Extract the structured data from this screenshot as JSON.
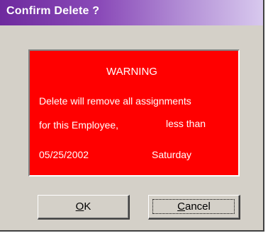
{
  "window": {
    "title": "Confirm Delete ?"
  },
  "warning": {
    "background_color": "#ff0000",
    "heading": "WARNING",
    "line1": "Delete will remove all assignments",
    "line2_left": "for this Employee,",
    "line2_right": "less than",
    "date": "05/25/2002",
    "day": "Saturday"
  },
  "buttons": {
    "ok": {
      "mnemonic": "O",
      "rest": "K"
    },
    "cancel": {
      "mnemonic": "C",
      "rest": "ancel"
    }
  }
}
